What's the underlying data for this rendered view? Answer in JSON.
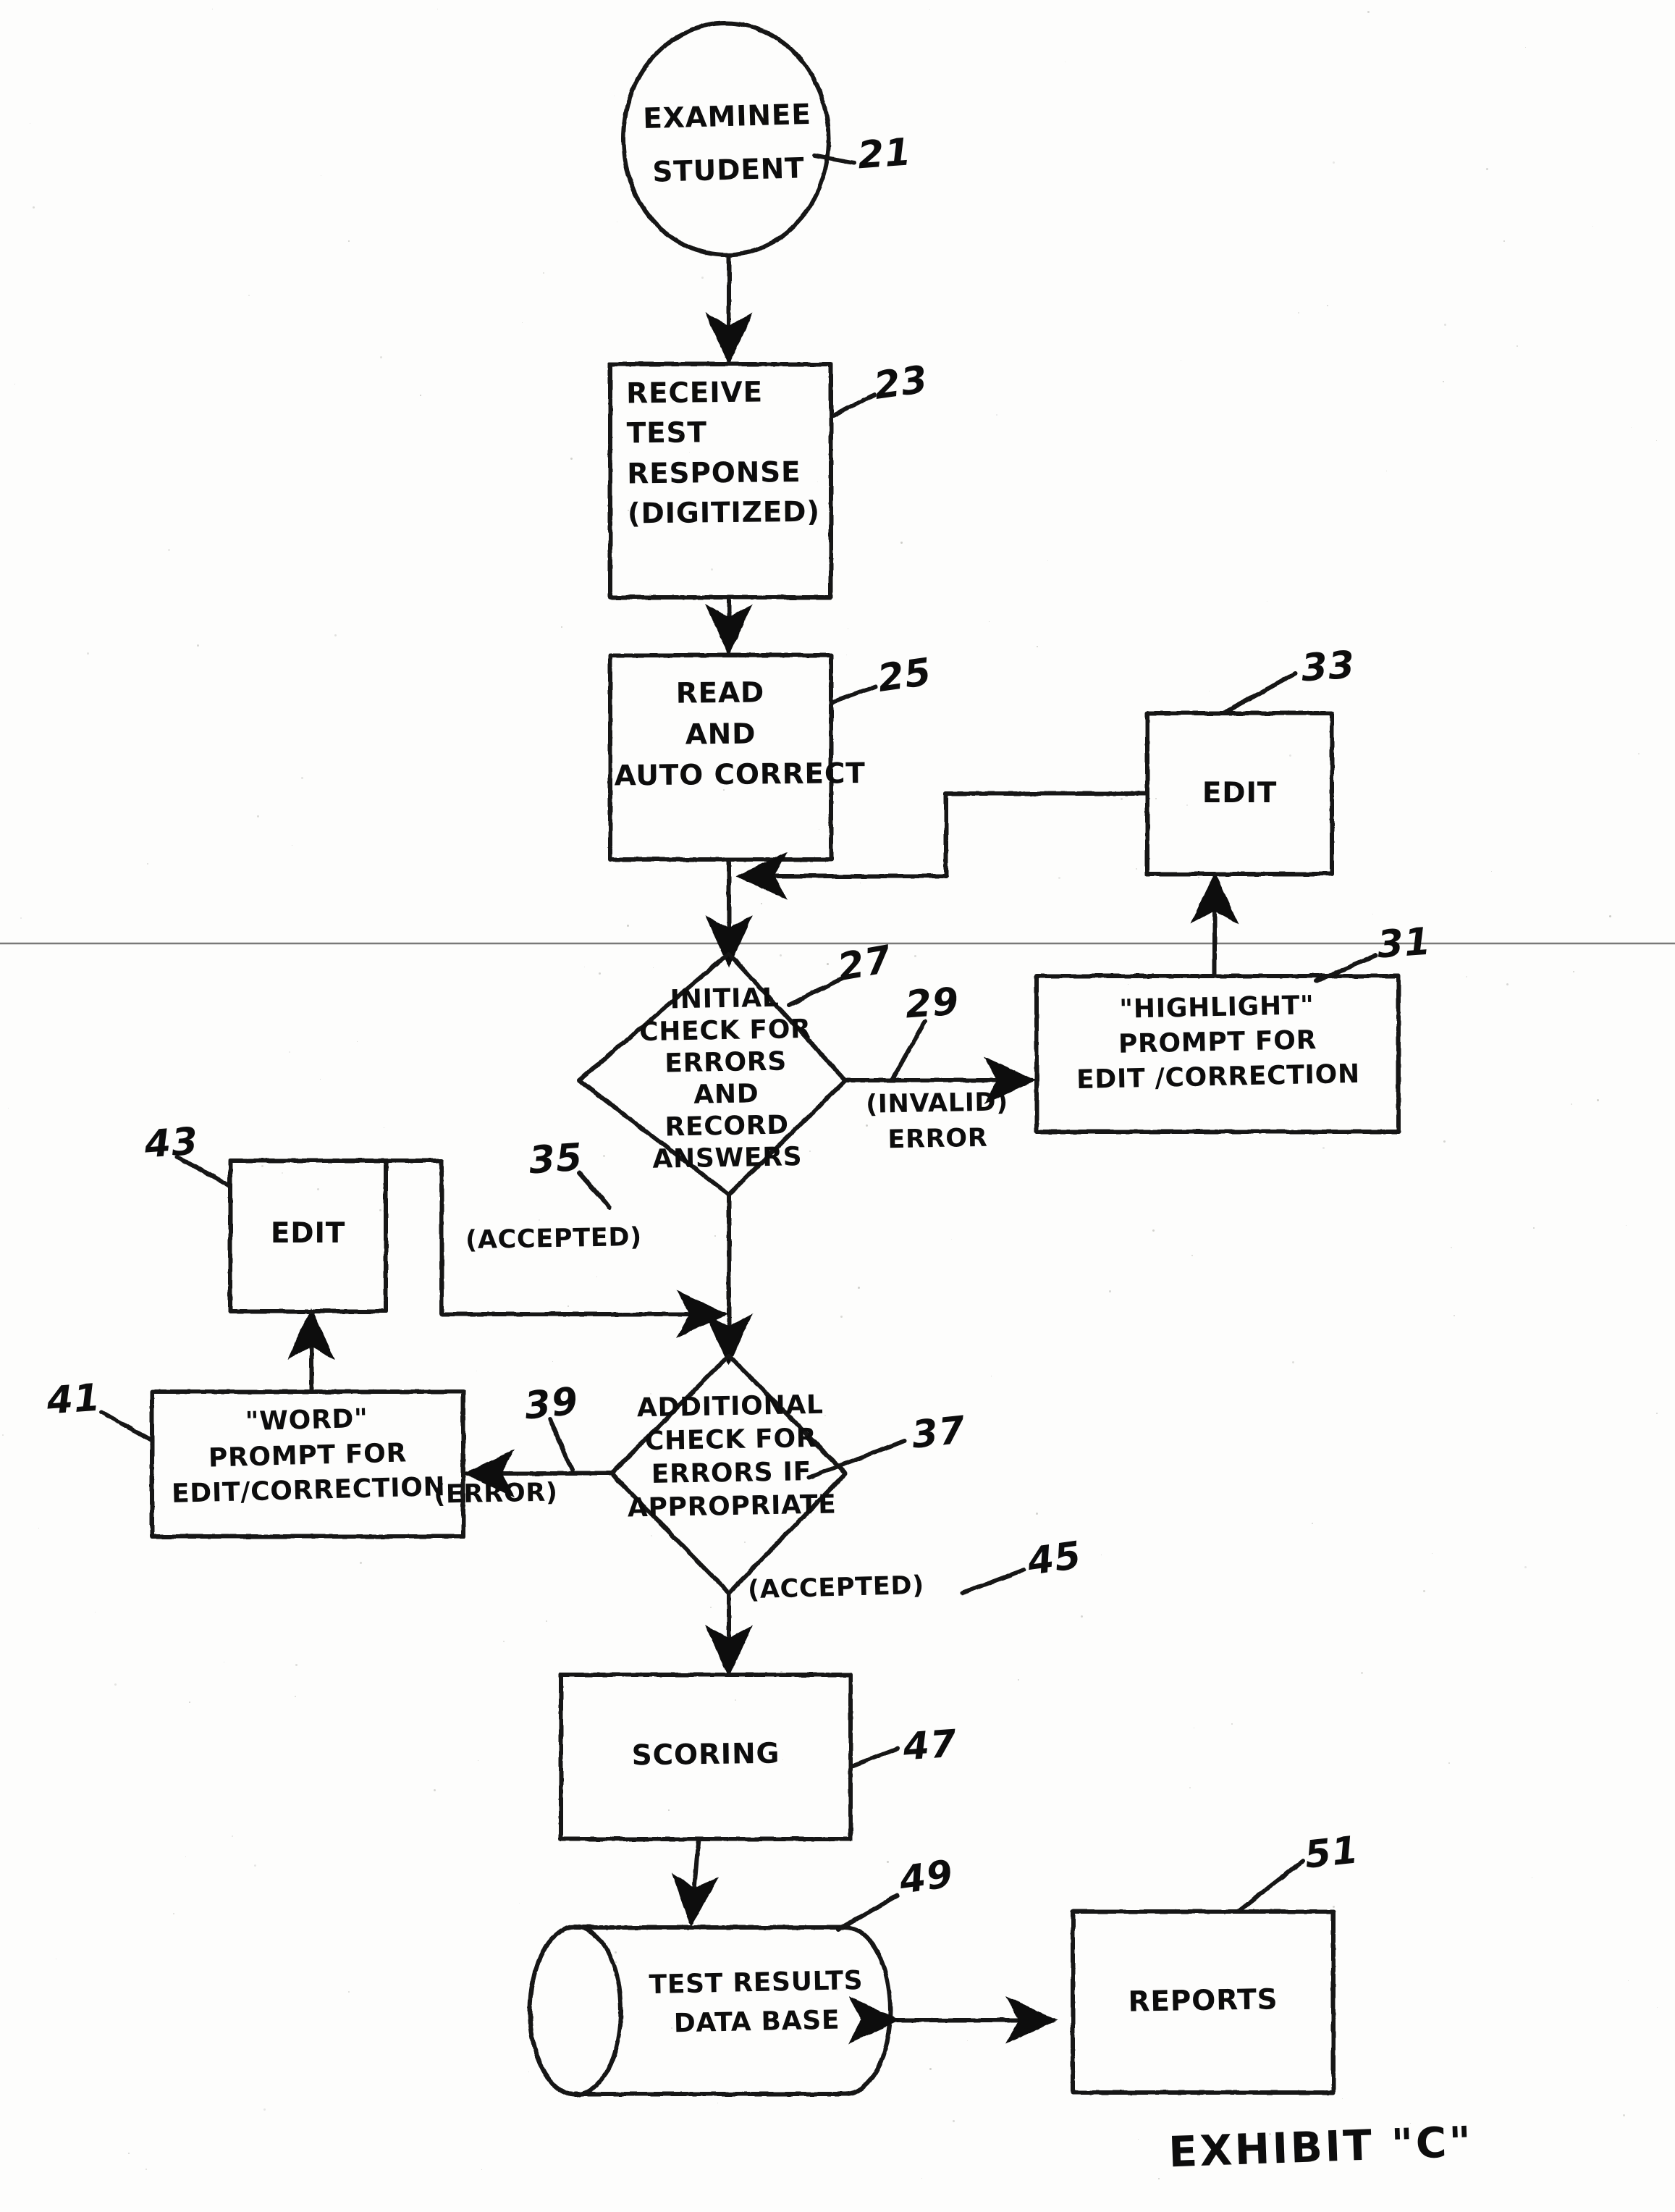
{
  "document": {
    "kind": "hand-drawn patent flowchart",
    "caption": "EXHIBIT \"C\""
  },
  "nodes": {
    "examinee": {
      "ref": "21",
      "label": "EXAMINEE\nSTUDENT",
      "shape": "circle"
    },
    "receive": {
      "ref": "23",
      "label": "RECEIVE\nTEST\nRESPONSE\n(DIGITIZED)",
      "shape": "rect"
    },
    "read": {
      "ref": "25",
      "label": "READ\nAND\nAUTO CORRECT",
      "shape": "rect"
    },
    "initial_check": {
      "ref": "27",
      "label": "INITIAL\nCHECK FOR\nERRORS\nAND\nRECORD\nANSWERS",
      "shape": "diamond"
    },
    "highlight_prompt": {
      "ref": "31",
      "label": "\"HIGHLIGHT\"\nPROMPT FOR\nEDIT /CORRECTION",
      "shape": "rect"
    },
    "edit_top": {
      "ref": "33",
      "label": "EDIT",
      "shape": "rect"
    },
    "additional_check": {
      "ref": "37",
      "label": "ADDITIONAL\nCHECK FOR\nERRORS IF\nAPPROPRIATE",
      "shape": "diamond"
    },
    "word_prompt": {
      "ref": "41",
      "label": "\"WORD\"\nPROMPT FOR\nEDIT/CORRECTION",
      "shape": "rect"
    },
    "edit_left": {
      "ref": "43",
      "label": "EDIT",
      "shape": "rect"
    },
    "scoring": {
      "ref": "47",
      "label": "SCORING",
      "shape": "rect"
    },
    "database": {
      "ref": "49",
      "label": "TEST RESULTS\nDATA BASE",
      "shape": "cylinder"
    },
    "reports": {
      "ref": "51",
      "label": "REPORTS",
      "shape": "rect"
    }
  },
  "edge_labels": {
    "invalid_error": {
      "ref": "29",
      "label": "(INVALID)\nERROR"
    },
    "accepted_initial": {
      "ref": "35",
      "label": "(ACCEPTED)"
    },
    "error_additional": {
      "ref": "39",
      "label": "(ERROR)"
    },
    "accepted_additional": {
      "ref": "45",
      "label": "(ACCEPTED)"
    }
  },
  "chart_data": {
    "type": "flowchart",
    "title": "EXHIBIT \"C\"",
    "nodes": [
      {
        "id": "21",
        "text": "EXAMINEE / STUDENT",
        "shape": "circle"
      },
      {
        "id": "23",
        "text": "RECEIVE TEST RESPONSE (DIGITIZED)",
        "shape": "process"
      },
      {
        "id": "25",
        "text": "READ AND AUTO CORRECT",
        "shape": "process"
      },
      {
        "id": "27",
        "text": "INITIAL CHECK FOR ERRORS AND RECORD ANSWERS",
        "shape": "decision"
      },
      {
        "id": "31",
        "text": "\"HIGHLIGHT\" PROMPT FOR EDIT /CORRECTION",
        "shape": "process"
      },
      {
        "id": "33",
        "text": "EDIT",
        "shape": "process"
      },
      {
        "id": "37",
        "text": "ADDITIONAL CHECK FOR ERRORS IF APPROPRIATE",
        "shape": "decision"
      },
      {
        "id": "41",
        "text": "\"WORD\" PROMPT FOR EDIT/CORRECTION",
        "shape": "process"
      },
      {
        "id": "43",
        "text": "EDIT",
        "shape": "process"
      },
      {
        "id": "47",
        "text": "SCORING",
        "shape": "process"
      },
      {
        "id": "49",
        "text": "TEST RESULTS DATA BASE",
        "shape": "cylinder"
      },
      {
        "id": "51",
        "text": "REPORTS",
        "shape": "process"
      }
    ],
    "edges": [
      {
        "from": "21",
        "to": "23",
        "label": ""
      },
      {
        "from": "23",
        "to": "25",
        "label": ""
      },
      {
        "from": "25",
        "to": "27",
        "label": ""
      },
      {
        "from": "27",
        "to": "31",
        "label": "(INVALID) ERROR",
        "label_ref": "29"
      },
      {
        "from": "31",
        "to": "33",
        "label": ""
      },
      {
        "from": "33",
        "to": "25",
        "label": ""
      },
      {
        "from": "27",
        "to": "37",
        "label": "(ACCEPTED)",
        "label_ref": "35"
      },
      {
        "from": "37",
        "to": "41",
        "label": "(ERROR)",
        "label_ref": "39"
      },
      {
        "from": "41",
        "to": "43",
        "label": ""
      },
      {
        "from": "43",
        "to": "37",
        "label": ""
      },
      {
        "from": "37",
        "to": "47",
        "label": "(ACCEPTED)",
        "label_ref": "45"
      },
      {
        "from": "47",
        "to": "49",
        "label": ""
      },
      {
        "from": "49",
        "to": "51",
        "label": "",
        "bidirectional": true
      }
    ]
  }
}
